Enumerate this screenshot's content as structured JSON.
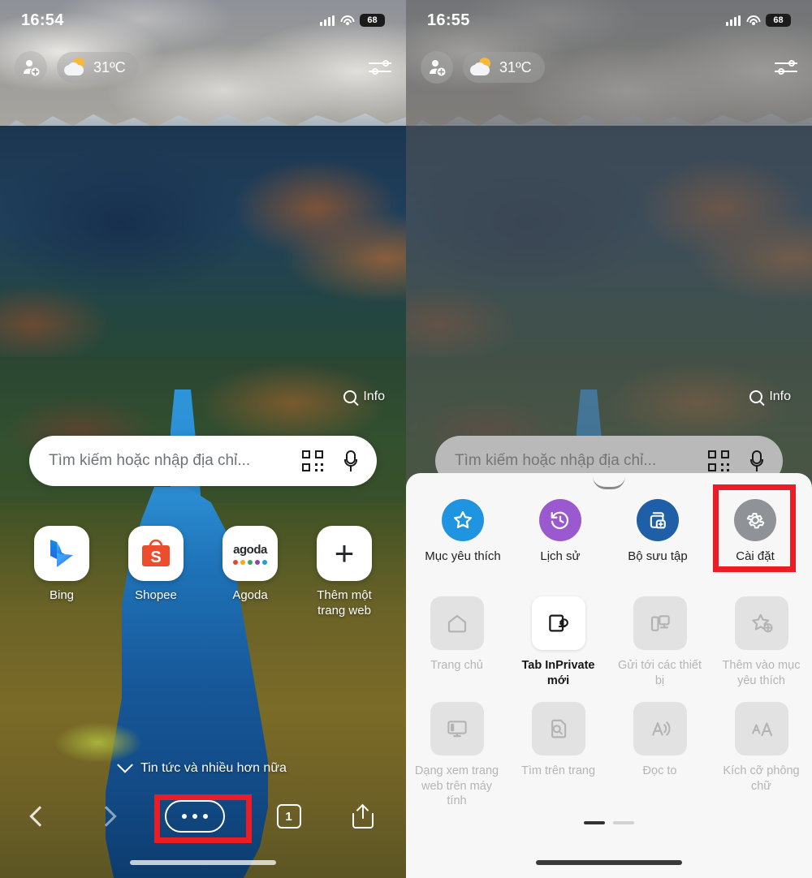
{
  "left_phone": {
    "statusbar": {
      "time": "16:54",
      "battery": "68",
      "signal_icon": "cellular-bars-icon",
      "wifi_icon": "wifi-icon"
    },
    "chips": {
      "avatar_icon": "add-profile-icon",
      "weather_icon": "sun-cloud-icon",
      "weather_temp": "31ºC",
      "settings_icon": "sliders-icon"
    },
    "info": {
      "search_icon": "search-icon",
      "label": "Info"
    },
    "search": {
      "placeholder": "Tìm kiếm hoặc nhập địa chỉ...",
      "qr_icon": "qr-code-icon",
      "mic_icon": "microphone-icon"
    },
    "shortcuts": [
      {
        "label": "Bing",
        "icon": "bing-logo-icon"
      },
      {
        "label": "Shopee",
        "icon": "shopee-logo-icon"
      },
      {
        "label": "Agoda",
        "icon": "agoda-logo-icon",
        "logo_text": "agoda"
      },
      {
        "label": "Thêm một trang web",
        "icon": "plus-icon"
      }
    ],
    "news": {
      "chevron_icon": "chevron-down-icon",
      "label": "Tin tức và nhiều hơn nữa"
    },
    "bottomnav": {
      "back_icon": "chevron-left-icon",
      "forward_icon": "chevron-right-icon",
      "more_icon": "ellipsis-icon",
      "tab_count": "1",
      "share_icon": "share-icon"
    }
  },
  "right_phone": {
    "statusbar": {
      "time": "16:55",
      "battery": "68",
      "signal_icon": "cellular-bars-icon",
      "wifi_icon": "wifi-icon"
    },
    "chips": {
      "avatar_icon": "add-profile-icon",
      "weather_icon": "sun-cloud-icon",
      "weather_temp": "31ºC",
      "settings_icon": "sliders-icon"
    },
    "info": {
      "search_icon": "search-icon",
      "label": "Info"
    },
    "search": {
      "placeholder": "Tìm kiếm hoặc nhập địa chỉ...",
      "qr_icon": "qr-code-icon",
      "mic_icon": "microphone-icon"
    },
    "sheet": {
      "handle_icon": "drag-handle-icon",
      "quick_actions": [
        {
          "label": "Mục yêu thích",
          "icon": "star-icon",
          "color": "#1f94e0"
        },
        {
          "label": "Lịch sử",
          "icon": "history-clock-icon",
          "color": "#9b59d0"
        },
        {
          "label": "Bộ sưu tập",
          "icon": "collections-icon",
          "color": "#1f5fa8"
        },
        {
          "label": "Cài đặt",
          "icon": "gear-icon",
          "color": "#8f9397"
        }
      ],
      "grid": [
        {
          "label": "Trang chủ",
          "icon": "home-icon",
          "enabled": false
        },
        {
          "label": "Tab InPrivate mới",
          "icon": "inprivate-icon",
          "enabled": true
        },
        {
          "label": "Gửi tới các thiết bị",
          "icon": "send-to-devices-icon",
          "enabled": false
        },
        {
          "label": "Thêm vào mục yêu thích",
          "icon": "add-favorite-icon",
          "enabled": false
        },
        {
          "label": "Dạng xem trang web trên máy tính",
          "icon": "desktop-view-icon",
          "enabled": false
        },
        {
          "label": "Tìm trên trang",
          "icon": "find-on-page-icon",
          "enabled": false
        },
        {
          "label": "Đọc to",
          "icon": "read-aloud-icon",
          "enabled": false
        },
        {
          "label": "Kích cỡ phông chữ",
          "icon": "font-size-icon",
          "enabled": false
        }
      ],
      "pager": {
        "pages": 2,
        "active": 1
      }
    }
  },
  "annotations": {
    "highlight_color": "#ec1c24",
    "boxes": [
      {
        "name": "more-button-highlight",
        "target": "ellipsis-button"
      },
      {
        "name": "settings-highlight",
        "target": "cai-dat-quick-action"
      }
    ]
  }
}
